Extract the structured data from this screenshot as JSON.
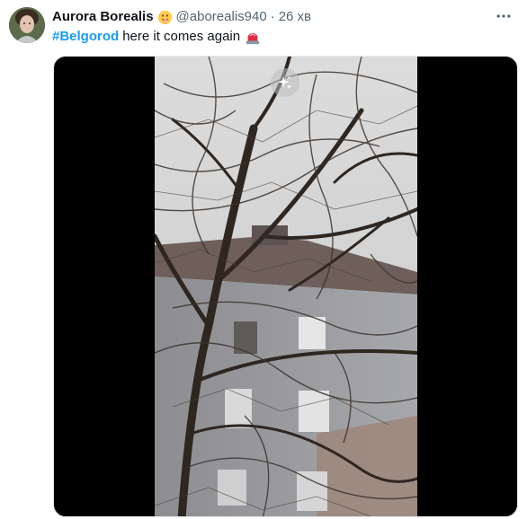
{
  "author": {
    "display_name": "Aurora Borealis",
    "name_emoji": "shushing-face-emoji",
    "handle": "@aborealis940",
    "separator": "·",
    "timestamp": "26 хв"
  },
  "tweet": {
    "hashtag": "#Belgorod",
    "body": "here it comes again",
    "trailing_emoji": "police-siren-emoji"
  },
  "media": {
    "type": "video",
    "overlay_icon": "sparkle-icon"
  },
  "colors": {
    "accent": "#1d9bf0",
    "text_primary": "#0f1419",
    "text_secondary": "#536471",
    "media_background": "#000000"
  }
}
